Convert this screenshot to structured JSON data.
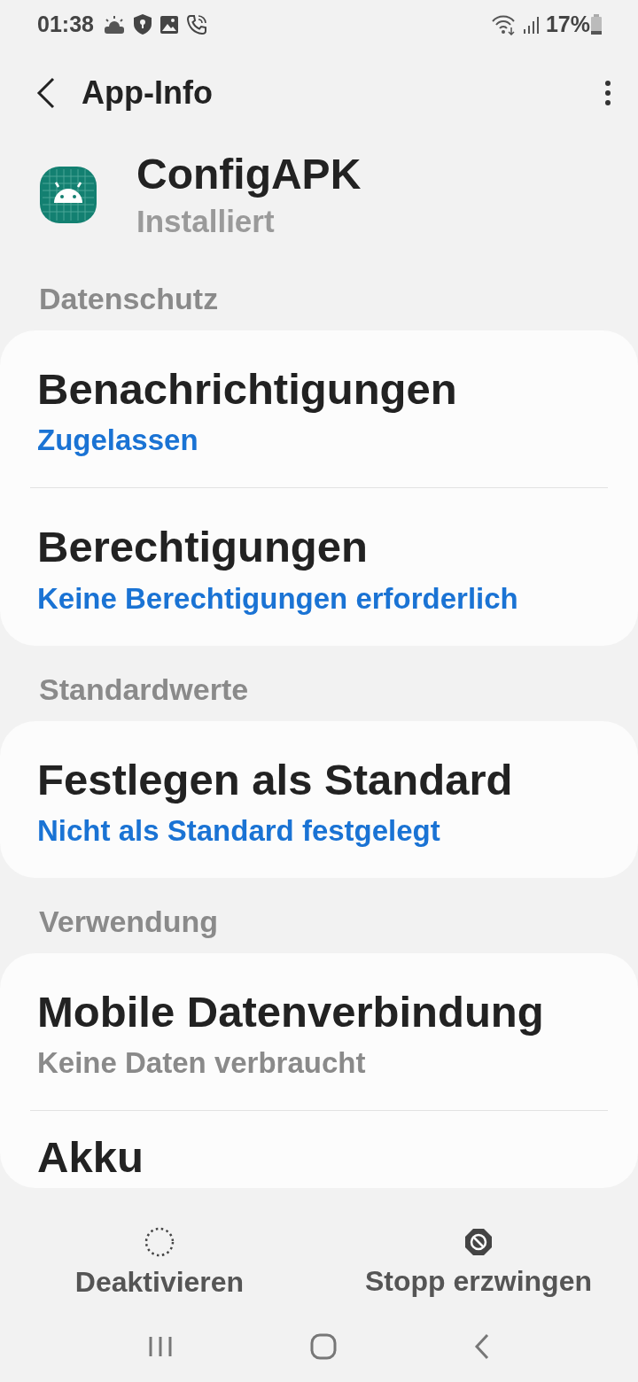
{
  "status_bar": {
    "time": "01:38",
    "battery": "17%"
  },
  "app_bar": {
    "title": "App-Info"
  },
  "app": {
    "name": "ConfigAPK",
    "status": "Installiert"
  },
  "sections": [
    {
      "label": "Datenschutz",
      "items": [
        {
          "title": "Benachrichtigungen",
          "subtitle": "Zugelassen",
          "kind": "link"
        },
        {
          "title": "Berechtigungen",
          "subtitle": "Keine Berechtigungen erforderlich",
          "kind": "link"
        }
      ]
    },
    {
      "label": "Standardwerte",
      "items": [
        {
          "title": "Festlegen als Standard",
          "subtitle": "Nicht als Standard festgelegt",
          "kind": "link"
        }
      ]
    },
    {
      "label": "Verwendung",
      "items": [
        {
          "title": "Mobile Datenverbindung",
          "subtitle": "Keine Daten verbraucht",
          "kind": "info"
        },
        {
          "title": "Akku"
        }
      ]
    }
  ],
  "actions": [
    {
      "label": "Deaktivieren",
      "kind": "disable"
    },
    {
      "label": "Stopp erzwingen",
      "kind": "force_stop"
    }
  ]
}
